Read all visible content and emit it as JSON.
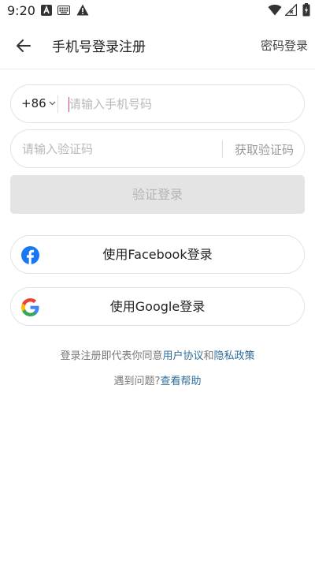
{
  "status_bar": {
    "time": "9:20",
    "icons_left": [
      "text-a-icon",
      "keyboard-icon",
      "warning-icon"
    ],
    "icons_right": [
      "wifi-icon",
      "signal-icon",
      "battery-icon"
    ]
  },
  "header": {
    "back_icon": "arrow-left-icon",
    "title": "手机号登录注册",
    "password_login": "密码登录"
  },
  "phone_field": {
    "country_code": "+86",
    "placeholder": "请输入手机号码",
    "value": ""
  },
  "code_field": {
    "placeholder": "请输入验证码",
    "value": "",
    "get_code": "获取验证码"
  },
  "verify_button": {
    "label": "验证登录"
  },
  "social": {
    "facebook": {
      "label": "使用Facebook登录",
      "icon": "facebook-icon",
      "color": "#1877f2"
    },
    "google": {
      "label": "使用Google登录",
      "icon": "google-icon"
    }
  },
  "terms": {
    "prefix": "登录注册即代表你同意",
    "user_agreement": "用户协议",
    "and": "和",
    "privacy_policy": "隐私政策"
  },
  "help": {
    "prefix": "遇到问题?",
    "link": "查看帮助"
  },
  "colors": {
    "link": "#2f6d9a",
    "caret": "#e0407a",
    "disabled_button_bg": "#e4e4e4"
  }
}
